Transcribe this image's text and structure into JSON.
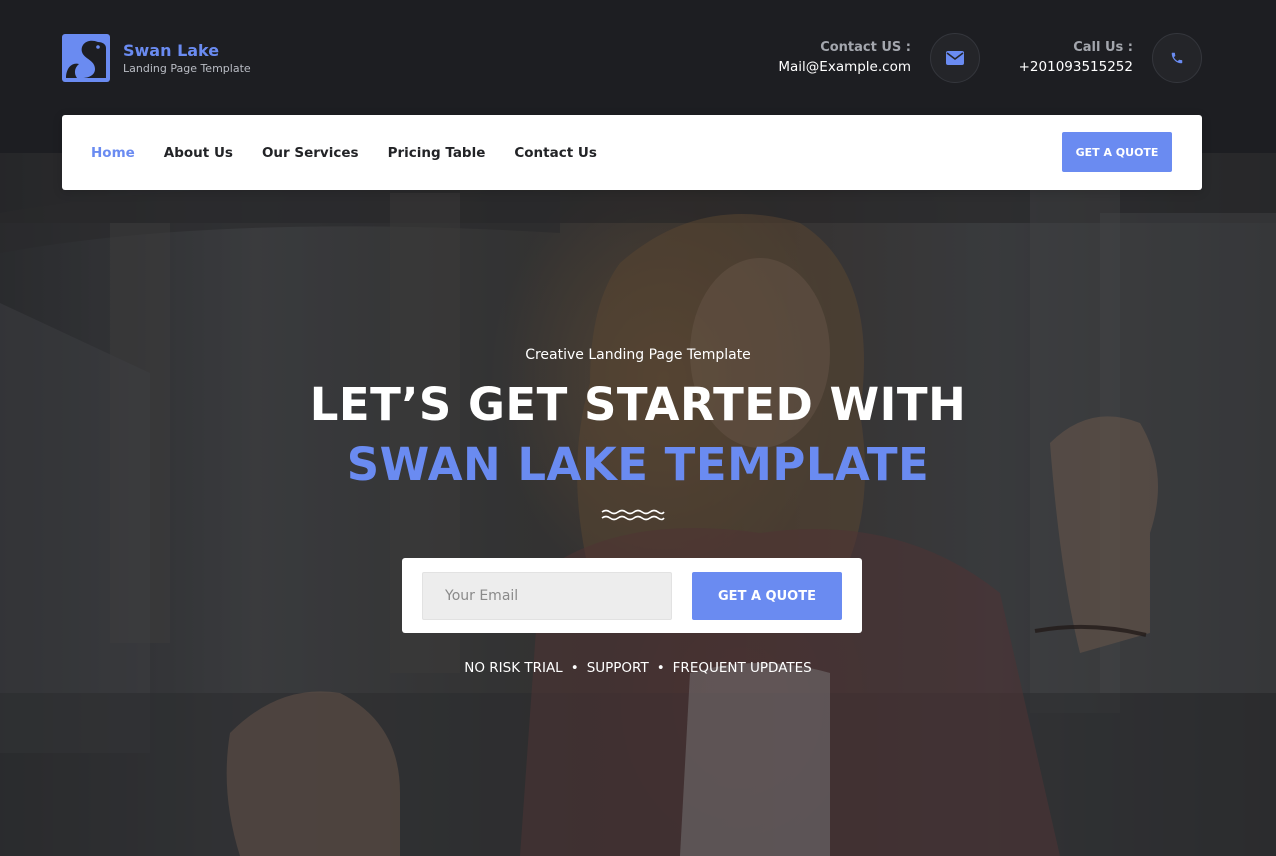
{
  "brand": {
    "name": "Swan Lake",
    "tagline": "Landing Page Template"
  },
  "contact": {
    "email_label": "Contact US :",
    "email_value": "Mail@Example.com",
    "email_icon": "envelope-icon",
    "phone_label": "Call Us :",
    "phone_value": "+201093515252",
    "phone_icon": "phone-icon"
  },
  "nav": {
    "items": [
      {
        "label": "Home",
        "active": true
      },
      {
        "label": "About Us",
        "active": false
      },
      {
        "label": "Our Services",
        "active": false
      },
      {
        "label": "Pricing Table",
        "active": false
      },
      {
        "label": "Contact Us",
        "active": false
      }
    ],
    "cta_label": "GET A QUOTE"
  },
  "hero": {
    "tagline": "Creative Landing Page Template",
    "headline_line1": "LET’S GET STARTED WITH",
    "headline_line2": "SWAN LAKE TEMPLATE",
    "divider_icon": "wave-icon",
    "email_placeholder": "Your Email",
    "cta_label": "GET A QUOTE",
    "features": [
      "NO RISK TRIAL",
      "SUPPORT",
      "FREQUENT UPDATES"
    ],
    "separator": "•"
  },
  "colors": {
    "accent": "#6a8bf1",
    "topbar_bg": "#1d1e22",
    "nav_bg": "#ffffff",
    "heading_text": "#ffffff"
  }
}
